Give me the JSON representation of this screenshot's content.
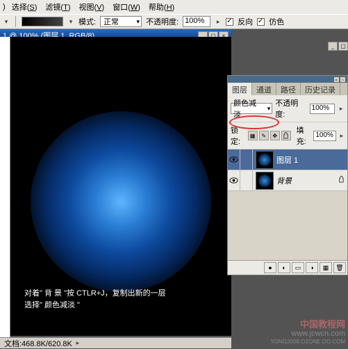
{
  "menubar": {
    "items": [
      {
        "label": "选择",
        "key": "S"
      },
      {
        "label": "滤镜",
        "key": "T"
      },
      {
        "label": "视图",
        "key": "V"
      },
      {
        "label": "窗口",
        "key": "W"
      },
      {
        "label": "帮助",
        "key": "H"
      }
    ],
    "leading": ")"
  },
  "optionbar": {
    "mode_label": "模式:",
    "mode_value": "正常",
    "opacity_label": "不透明度:",
    "opacity_value": "100%",
    "reverse_label": "反向",
    "dither_label": "仿色"
  },
  "doc": {
    "title": "1 @ 100% (图层 1, RGB/8)",
    "status": "文档:468.8K/620.8K"
  },
  "caption": {
    "line1": "对着\" 背 景 \"按 CTLR+J，复制出新的一层",
    "line2": "选择\" 颜色减淡 \""
  },
  "panel": {
    "tabs": [
      "图层",
      "通道",
      "路径",
      "历史记录"
    ],
    "blend_value": "颜色减淡",
    "opacity_label": "不透明度:",
    "opacity_value": "100%",
    "lock_label": "锁定:",
    "fill_label": "填充:",
    "fill_value": "100%",
    "layers": [
      {
        "name": "图层 1",
        "selected": true
      },
      {
        "name": "背景",
        "selected": false,
        "italic": true,
        "locked": true
      }
    ]
  },
  "watermark": {
    "cn": "中国教程网",
    "url1": "www.jcwcn.com",
    "url2": "YONG2008.OZONE.OO.COM"
  }
}
